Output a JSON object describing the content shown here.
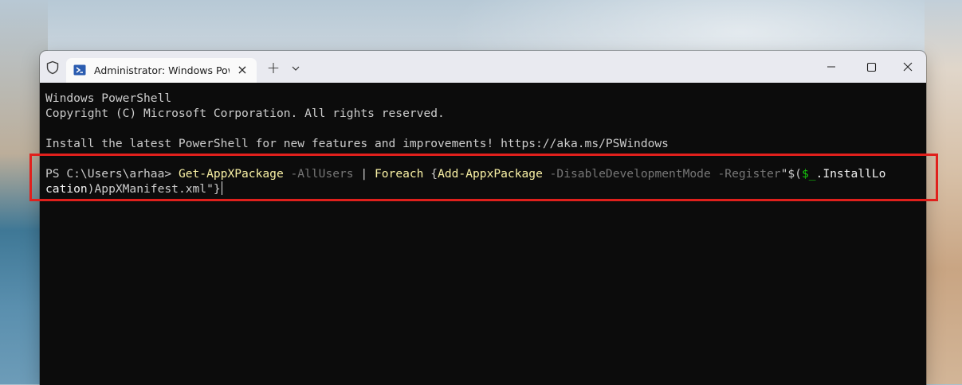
{
  "window": {
    "tab_title": "Administrator: Windows PowerShell",
    "new_tab_label": "+"
  },
  "terminal": {
    "banner_title": "Windows PowerShell",
    "copyright": "Copyright (C) Microsoft Corporation. All rights reserved.",
    "install_notice": "Install the latest PowerShell for new features and improvements! https://aka.ms/PSWindows",
    "command": {
      "prompt": "PS C:\\Users\\arhaa> ",
      "cmdlet1": "Get-AppXPackage",
      "param1": " -AllUsers",
      "pipe": " | ",
      "foreach": "Foreach",
      "brace_open": " {",
      "cmdlet2": "Add-AppxPackage",
      "param2": " -DisableDevelopmentMode",
      "param3": " -Register",
      "str_open": "\"$(",
      "var": "$_",
      "prop_line1": ".InstallLo",
      "prop_line2": "cation",
      "str_rest": ")AppXManifest.xml\"",
      "brace_close": "}"
    }
  },
  "colors": {
    "highlight_border": "#e0201c",
    "terminal_bg": "#0c0c0c",
    "cmdlet": "#f9f1a5",
    "parameter": "#767676",
    "variable": "#16c60c"
  },
  "icons": {
    "shield": "shield-icon",
    "powershell": "powershell-icon",
    "close_tab": "close-icon",
    "dropdown": "chevron-down-icon",
    "minimize": "minimize-icon",
    "maximize": "maximize-icon",
    "close_window": "close-icon"
  }
}
